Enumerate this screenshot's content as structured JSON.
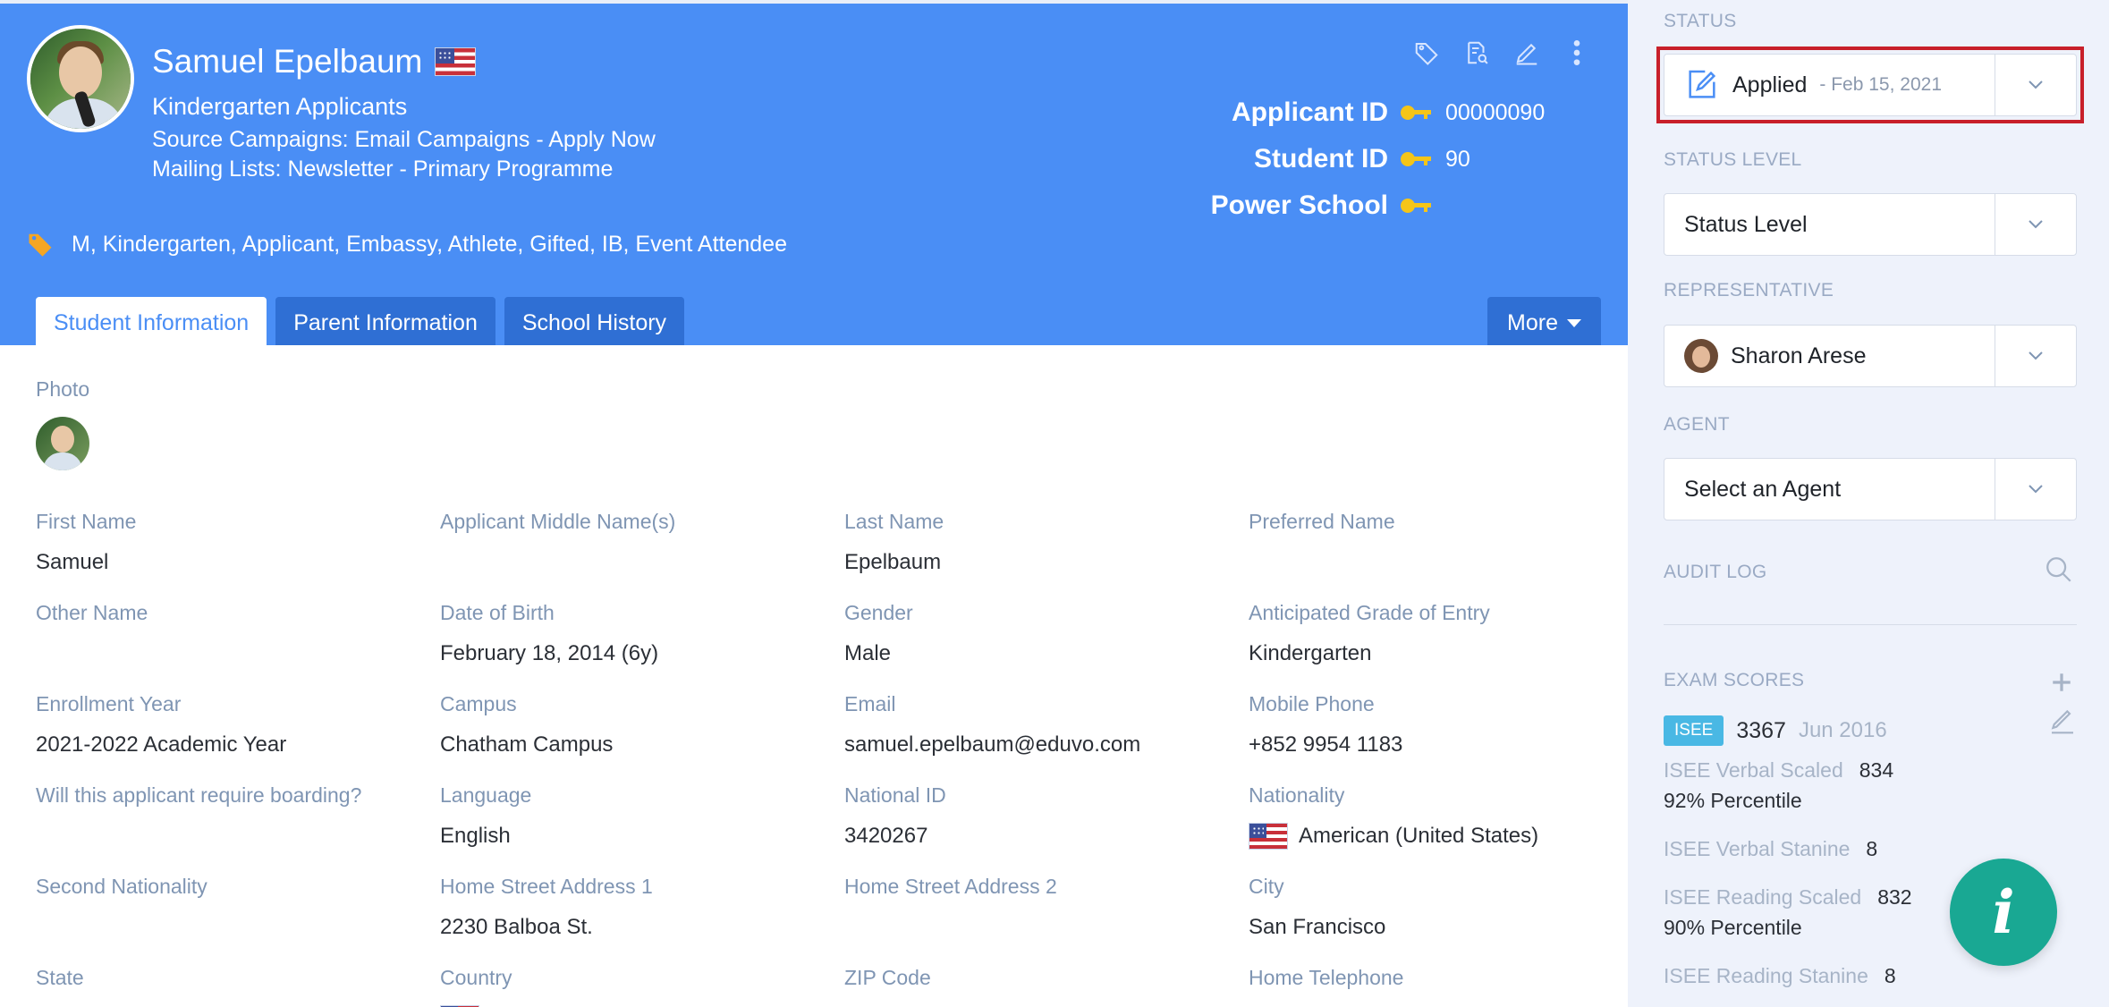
{
  "header": {
    "name": "Samuel Epelbaum",
    "group": "Kindergarten Applicants",
    "source_campaigns": "Source Campaigns: Email Campaigns - Apply Now",
    "mailing_lists": "Mailing Lists: Newsletter - Primary Programme",
    "ids": [
      {
        "label": "Applicant ID",
        "value": "00000090"
      },
      {
        "label": "Student ID",
        "value": "90"
      },
      {
        "label": "Power School",
        "value": ""
      }
    ],
    "tags": "M, Kindergarten, Applicant,  Embassy,  Athlete,  Gifted,  IB,  Event Attendee",
    "icons": [
      "tag-icon",
      "document-search-icon",
      "pencil-icon",
      "more-vertical-icon"
    ]
  },
  "tabs": [
    {
      "label": "Student Information",
      "active": true
    },
    {
      "label": "Parent Information",
      "active": false
    },
    {
      "label": "School History",
      "active": false
    }
  ],
  "more_label": "More",
  "main": {
    "photo_label": "Photo",
    "fields": [
      {
        "label": "First Name",
        "value": "Samuel"
      },
      {
        "label": "Applicant Middle Name(s)",
        "value": ""
      },
      {
        "label": "Last Name",
        "value": "Epelbaum"
      },
      {
        "label": "Preferred Name",
        "value": ""
      },
      {
        "label": "Other Name",
        "value": ""
      },
      {
        "label": "Date of Birth",
        "value": "February 18, 2014 (6y)"
      },
      {
        "label": "Gender",
        "value": "Male"
      },
      {
        "label": "Anticipated Grade of Entry",
        "value": "Kindergarten"
      },
      {
        "label": "Enrollment Year",
        "value": "2021-2022 Academic Year"
      },
      {
        "label": "Campus",
        "value": "Chatham Campus"
      },
      {
        "label": "Email",
        "value": "samuel.epelbaum@eduvo.com"
      },
      {
        "label": "Mobile Phone",
        "value": "+852 9954 1183"
      },
      {
        "label": "Will this applicant require boarding?",
        "value": ""
      },
      {
        "label": "Language",
        "value": "English"
      },
      {
        "label": "National ID",
        "value": "3420267"
      },
      {
        "label": "Nationality",
        "value": "American (United States)"
      },
      {
        "label": "Second Nationality",
        "value": ""
      },
      {
        "label": "Home Street Address 1",
        "value": "2230 Balboa St."
      },
      {
        "label": "Home Street Address 2",
        "value": ""
      },
      {
        "label": "City",
        "value": "San Francisco"
      },
      {
        "label": "State",
        "value": ""
      },
      {
        "label": "Country",
        "value": ""
      },
      {
        "label": "ZIP Code",
        "value": ""
      },
      {
        "label": "Home Telephone",
        "value": ""
      }
    ]
  },
  "panel": {
    "status_label": "STATUS",
    "status_value": "Applied",
    "status_date": "- Feb 15, 2021",
    "status_level_label": "STATUS LEVEL",
    "status_level_value": "Status Level",
    "representative_label": "REPRESENTATIVE",
    "representative_value": "Sharon Arese",
    "agent_label": "AGENT",
    "agent_value": "Select an Agent",
    "audit_log_label": "AUDIT LOG",
    "exam_scores_label": "EXAM SCORES",
    "exam": {
      "badge": "ISEE",
      "score": "3367",
      "date": "Jun 2016",
      "rows": [
        {
          "key": "ISEE Verbal Scaled",
          "value": "834",
          "percentile": "92% Percentile"
        },
        {
          "key": "ISEE Verbal Stanine",
          "value": "8",
          "percentile": ""
        },
        {
          "key": "ISEE Reading Scaled",
          "value": "832",
          "percentile": "90% Percentile"
        },
        {
          "key": "ISEE Reading Stanine",
          "value": "8",
          "percentile": ""
        }
      ]
    }
  },
  "colors": {
    "header_blue": "#4a8ef5",
    "tab_blue": "#2f6fd4",
    "panel_bg": "#eef2fb",
    "highlight_red": "#c8202a",
    "key_yellow": "#f5c518",
    "info_teal": "#19a893"
  }
}
